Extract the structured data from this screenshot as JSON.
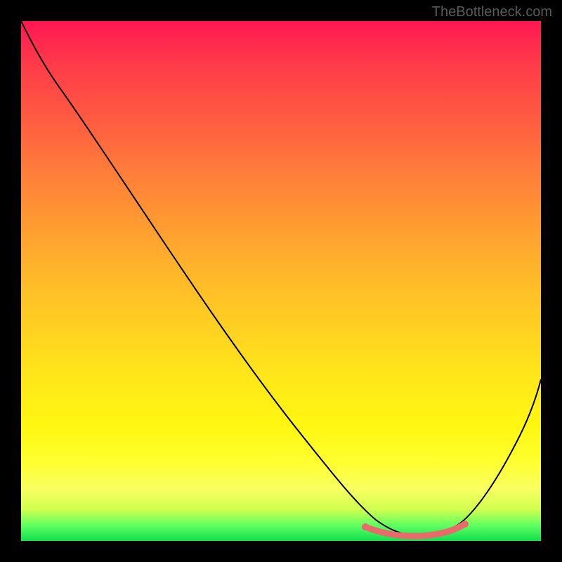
{
  "watermark": "TheBottleneck.com",
  "chart_data": {
    "type": "line",
    "title": "",
    "xlabel": "",
    "ylabel": "",
    "x_range": [
      0,
      100
    ],
    "y_range": [
      0,
      100
    ],
    "series": [
      {
        "name": "bottleneck-curve",
        "x": [
          0,
          3,
          8,
          15,
          25,
          35,
          45,
          55,
          62,
          67,
          70,
          73,
          76,
          80,
          85,
          90,
          95,
          100
        ],
        "y": [
          100,
          97,
          92,
          84,
          71,
          58,
          45,
          32,
          22,
          13,
          7,
          3,
          1,
          1,
          3,
          10,
          22,
          38
        ]
      }
    ],
    "markers": {
      "name": "optimal-range",
      "x": [
        67,
        70,
        73,
        76,
        78,
        80,
        82,
        84
      ],
      "y": [
        3.5,
        2.5,
        2,
        1.8,
        1.8,
        2,
        2.5,
        3.2
      ]
    },
    "gradient_description": "vertical red-to-green through orange-yellow representing bottleneck severity"
  }
}
